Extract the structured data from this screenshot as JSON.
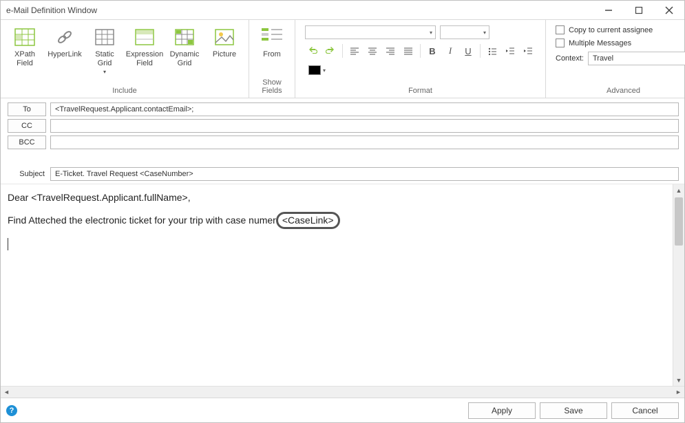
{
  "window": {
    "title": "e-Mail Definition Window"
  },
  "ribbon": {
    "include": {
      "label": "Include",
      "items": [
        {
          "name": "xpath-field",
          "label": "XPath\nField"
        },
        {
          "name": "hyperlink",
          "label": "HyperLink"
        },
        {
          "name": "static-grid",
          "label": "Static\nGrid",
          "dropdown": true
        },
        {
          "name": "expression-field",
          "label": "Expression\nField"
        },
        {
          "name": "dynamic-grid",
          "label": "Dynamic\nGrid"
        },
        {
          "name": "picture",
          "label": "Picture"
        }
      ]
    },
    "showfields": {
      "label": "Show Fields",
      "from_label": "From"
    },
    "format": {
      "label": "Format",
      "font": "",
      "size": "",
      "bold": "B",
      "italic": "I",
      "underline": "U"
    },
    "advanced": {
      "label": "Advanced",
      "copy_to_assignee": "Copy to current assignee",
      "multiple_messages": "Multiple Messages",
      "context_label": "Context:",
      "context_value": "Travel"
    }
  },
  "fields": {
    "to_label": "To",
    "to_value": "<TravelRequest.Applicant.contactEmail>;",
    "cc_label": "CC",
    "cc_value": "",
    "bcc_label": "BCC",
    "bcc_value": "",
    "subject_label": "Subject",
    "subject_value": "E-Ticket. Travel Request <CaseNumber>"
  },
  "body": {
    "line1_prefix": "Dear ",
    "line1_token": "<TravelRequest.Applicant.fullName>",
    "line1_suffix": ",",
    "line2_prefix": "Find Atteched the electronic ticket for your trip with case numer",
    "caselink": "<CaseLink>"
  },
  "footer": {
    "apply": "Apply",
    "save": "Save",
    "cancel": "Cancel"
  }
}
